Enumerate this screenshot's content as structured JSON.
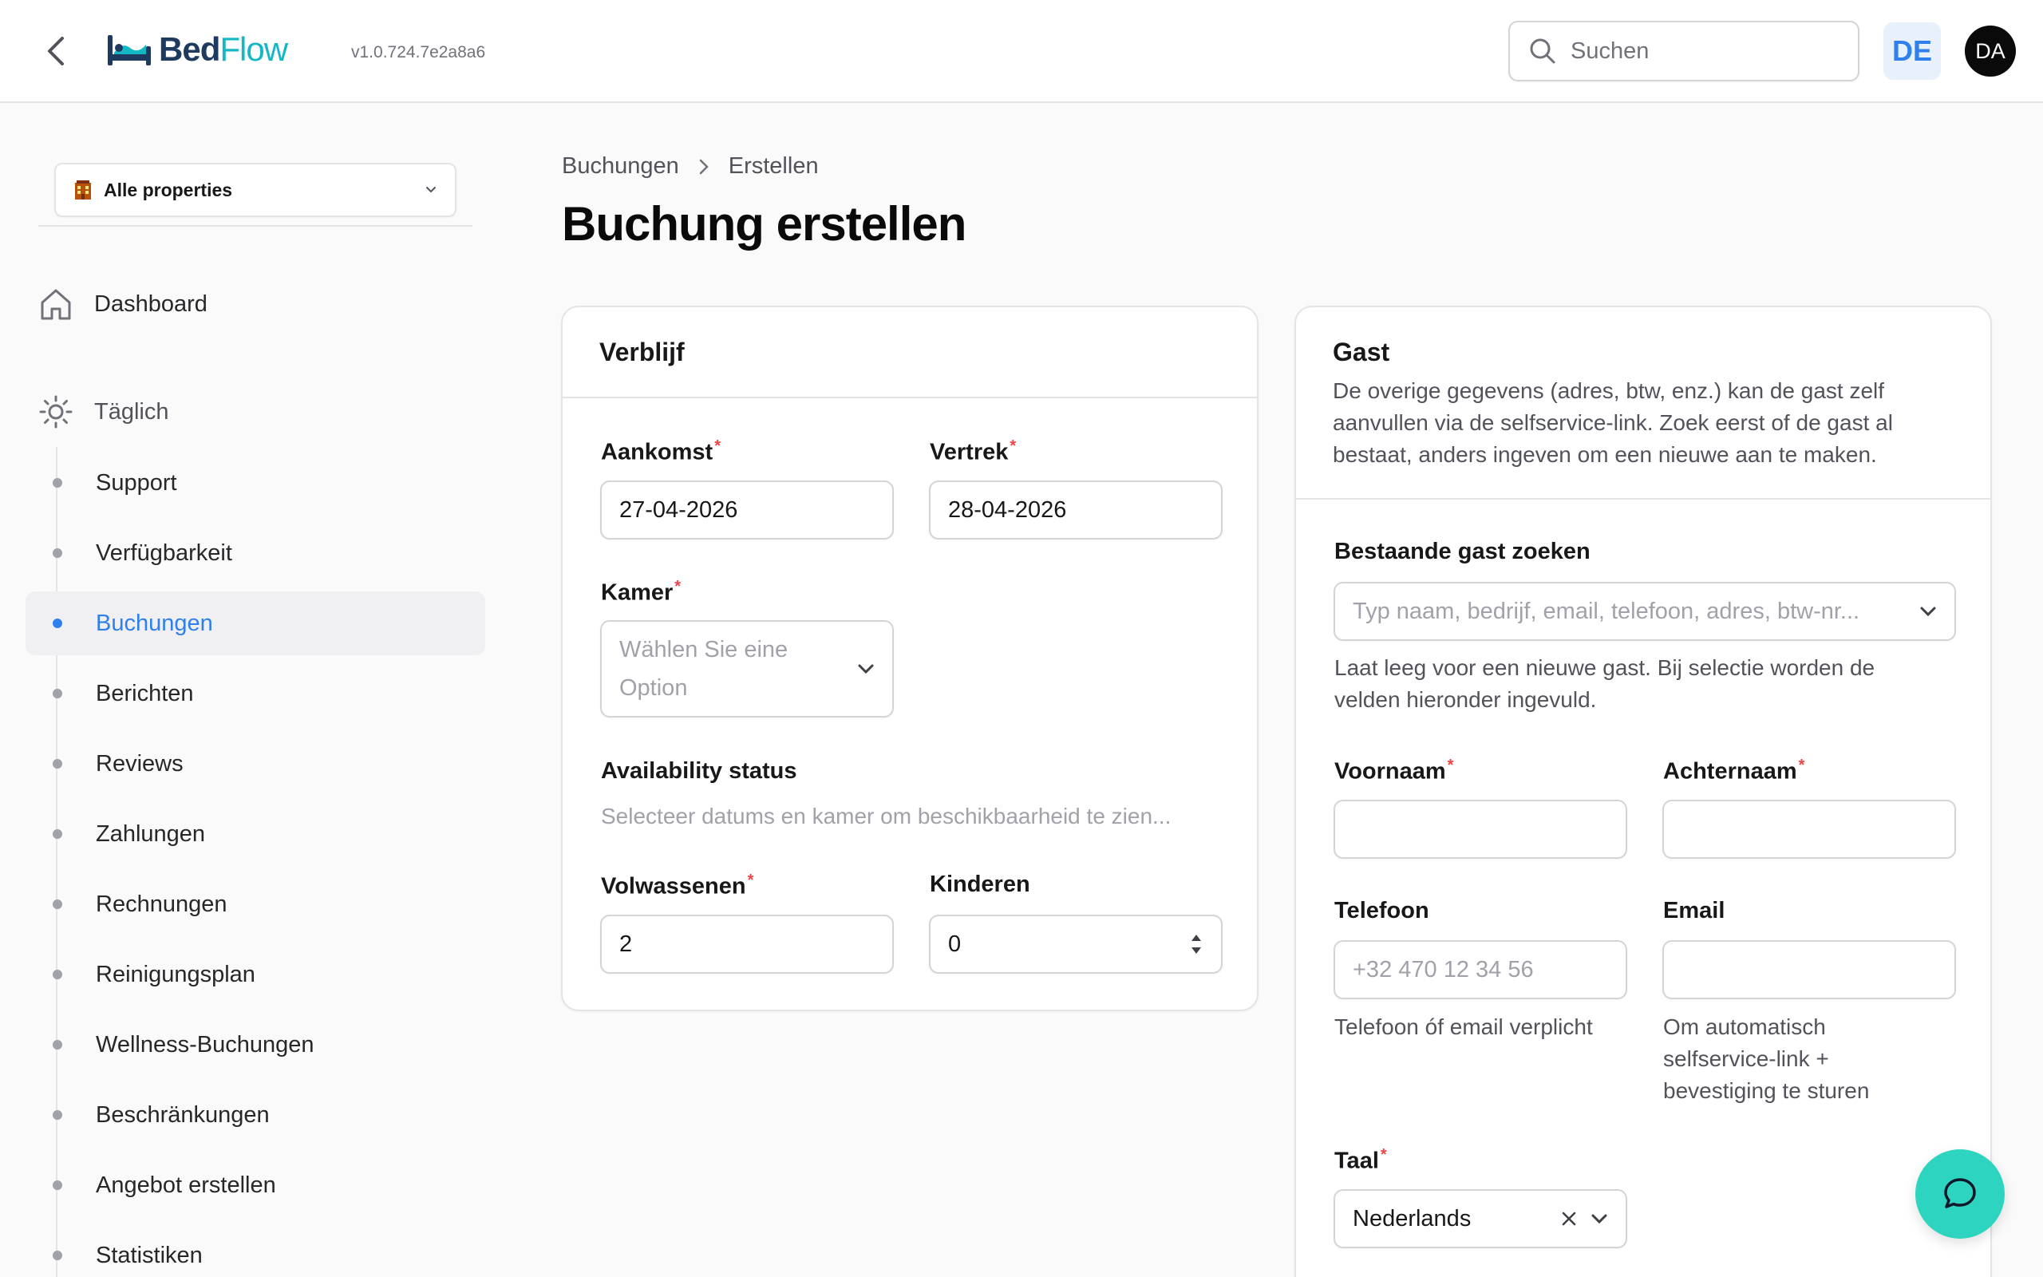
{
  "app": {
    "brand_part1": "Bed",
    "brand_part2": "Flow",
    "version": "v1.0.724.7e2a8a6"
  },
  "search": {
    "placeholder": "Suchen"
  },
  "language": "DE",
  "user_initials": "DA",
  "sidebar": {
    "property_select": "Alle properties",
    "dashboard": "Dashboard",
    "group": "Täglich",
    "items": [
      {
        "label": "Support",
        "active": false
      },
      {
        "label": "Verfügbarkeit",
        "active": false
      },
      {
        "label": "Buchungen",
        "active": true
      },
      {
        "label": "Berichten",
        "active": false
      },
      {
        "label": "Reviews",
        "active": false
      },
      {
        "label": "Zahlungen",
        "active": false
      },
      {
        "label": "Rechnungen",
        "active": false
      },
      {
        "label": "Reinigungsplan",
        "active": false
      },
      {
        "label": "Wellness-Buchungen",
        "active": false
      },
      {
        "label": "Beschränkungen",
        "active": false
      },
      {
        "label": "Angebot erstellen",
        "active": false
      },
      {
        "label": "Statistiken",
        "active": false
      }
    ]
  },
  "breadcrumb": {
    "parent": "Buchungen",
    "current": "Erstellen"
  },
  "page_title": "Buchung erstellen",
  "stay": {
    "title": "Verblijf",
    "arrival_label": "Aankomst",
    "arrival_value": "27-04-2026",
    "departure_label": "Vertrek",
    "departure_value": "28-04-2026",
    "room_label": "Kamer",
    "room_placeholder_1": "Wählen Sie eine",
    "room_placeholder_2": "Option",
    "availability_label": "Availability status",
    "availability_text": "Selecteer datums en kamer om beschikbaarheid te zien...",
    "adults_label": "Volwassenen",
    "adults_value": "2",
    "children_label": "Kinderen",
    "children_value": "0"
  },
  "guest": {
    "title": "Gast",
    "description_1": "De overige gegevens (adres, btw, enz.) kan de gast zelf",
    "description_2": "aanvullen via de selfservice-link. Zoek eerst of de gast al",
    "description_3": "bestaat, anders ingeven om een nieuwe aan te maken.",
    "search_label": "Bestaande gast zoeken",
    "search_placeholder": "Typ naam, bedrijf, email, telefoon, adres, btw-nr...",
    "search_help_1": "Laat leeg voor een nieuwe gast. Bij selectie worden de",
    "search_help_2": "velden hieronder ingevuld.",
    "firstname_label": "Voornaam",
    "firstname_value": "",
    "lastname_label": "Achternaam",
    "lastname_value": "",
    "phone_label": "Telefoon",
    "phone_placeholder": "+32 470 12 34 56",
    "phone_help": "Telefoon óf email verplicht",
    "email_label": "Email",
    "email_value": "",
    "email_help_1": "Om automatisch",
    "email_help_2": "selfservice-link +",
    "email_help_3": "bevestiging te sturen",
    "language_label": "Taal",
    "language_value": "Nederlands"
  },
  "colors": {
    "accent": "#2f80ed",
    "brand_teal": "#14b8c4",
    "fab": "#2dd4bf",
    "required": "#ef4444"
  }
}
